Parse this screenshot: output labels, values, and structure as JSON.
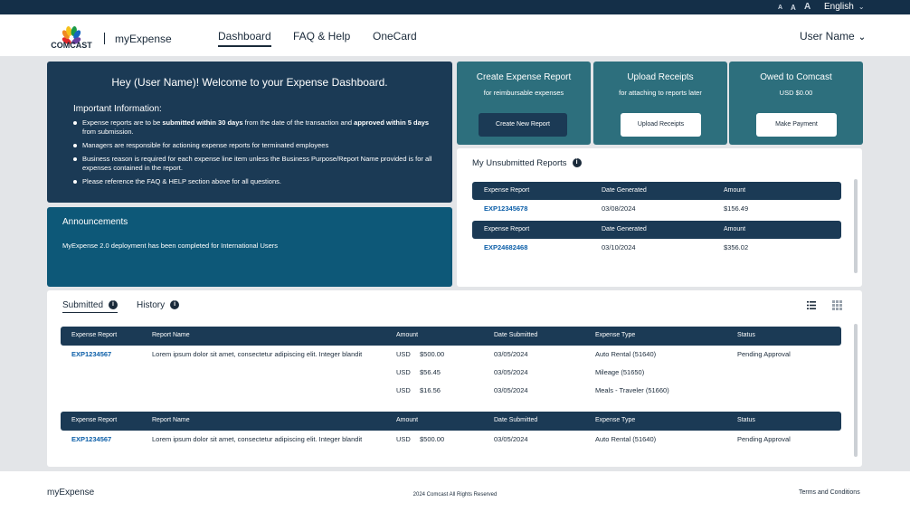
{
  "topbar": {
    "font_small": "A",
    "font_medium": "A",
    "font_large": "A",
    "language": "English"
  },
  "nav": {
    "brand_logo": "COMCAST",
    "brand_app": "myExpense",
    "dashboard": "Dashboard",
    "faq": "FAQ & Help",
    "onecard": "OneCard",
    "user": "User Name"
  },
  "welcome": {
    "title": "Hey (User Name)!  Welcome to your Expense Dashboard.",
    "info_title": "Important Information:",
    "bullet1_pre": "Expense reports are to be ",
    "bullet1_bold1": "submitted within 30 days",
    "bullet1_mid": " from the date of the transaction and ",
    "bullet1_bold2": "approved within 5 days",
    "bullet1_post": " from submission.",
    "bullet2": "Managers are responsible for actioning expense reports for terminated employees",
    "bullet3": "Business reason is required for each expense line item unless the Business Purpose/Report Name provided is for all expenses contained in the report.",
    "bullet4": "Please reference the FAQ & HELP section above for all questions."
  },
  "announcements": {
    "title": "Announcements",
    "text": "MyExpense 2.0 deployment has been completed for International Users"
  },
  "cards": {
    "create": {
      "title": "Create Expense Report",
      "subtitle": "for reimbursable expenses",
      "button": "Create New Report"
    },
    "upload": {
      "title": "Upload Receipts",
      "subtitle": "for attaching to reports later",
      "button": "Upload Receipts"
    },
    "owed": {
      "title": "Owed to Comcast",
      "subtitle": "USD $0.00",
      "button": "Make Payment"
    }
  },
  "unsubmitted": {
    "title": "My Unsubmitted Reports",
    "info": "i",
    "headers": [
      "Expense Report",
      "Date Generated",
      "Amount"
    ],
    "rows": [
      {
        "report": "EXP12345678",
        "date": "03/08/2024",
        "amount": "$156.49"
      },
      {
        "report": "EXP24682468",
        "date": "03/10/2024",
        "amount": "$356.02"
      }
    ]
  },
  "submitted": {
    "tab_submitted": "Submitted",
    "tab_history": "History",
    "info": "i",
    "headers": [
      "Expense Report",
      "Report Name",
      "Amount",
      "Date Submitted",
      "Expense Type",
      "Status"
    ],
    "groups": [
      {
        "report": "EXP1234567",
        "name": "Lorem ipsum dolor sit amet, consectetur adipiscing elit. Integer blandit",
        "status": "Pending Approval",
        "lines": [
          {
            "currency": "USD",
            "amount": "$500.00",
            "date": "03/05/2024",
            "type": "Auto Rental (51640)"
          },
          {
            "currency": "USD",
            "amount": "$56.45",
            "date": "03/05/2024",
            "type": "Mileage (51650)"
          },
          {
            "currency": "USD",
            "amount": "$16.56",
            "date": "03/05/2024",
            "type": "Meals - Traveler (51660)"
          }
        ]
      },
      {
        "report": "EXP1234567",
        "name": "Lorem ipsum dolor sit amet, consectetur adipiscing elit. Integer blandit",
        "status": "Pending Approval",
        "lines": [
          {
            "currency": "USD",
            "amount": "$500.00",
            "date": "03/05/2024",
            "type": "Auto Rental (51640)"
          }
        ]
      }
    ]
  },
  "footer": {
    "brand": "myExpense",
    "copyright": "2024 Comcast All Rights Reserved",
    "terms": "Terms and Conditions"
  },
  "colors": {
    "navy": "#1b3a55",
    "teal": "#2d6f7d",
    "blue": "#0d5878",
    "link": "#0b5ea8",
    "topbar": "#142f48"
  }
}
